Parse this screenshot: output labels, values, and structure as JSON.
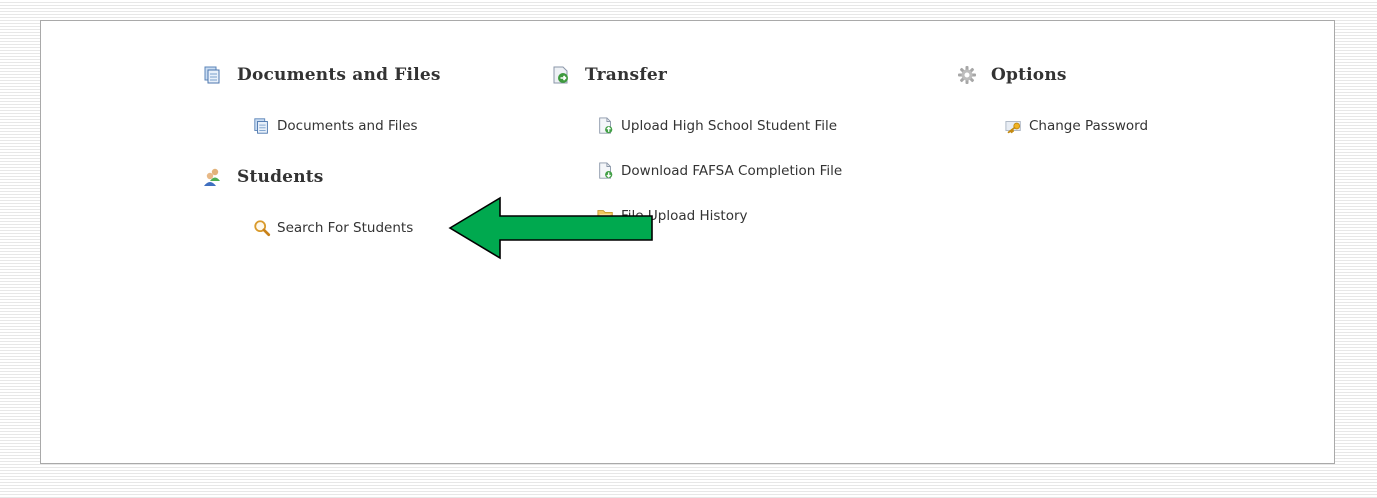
{
  "sections": {
    "documents": {
      "title": "Documents and Files",
      "icon": "documents-icon",
      "items": [
        {
          "label": "Documents and Files",
          "icon": "documents-icon"
        }
      ]
    },
    "students": {
      "title": "Students",
      "icon": "users-icon",
      "items": [
        {
          "label": "Search For Students",
          "icon": "magnifier-icon"
        }
      ]
    },
    "transfer": {
      "title": "Transfer",
      "icon": "transfer-icon",
      "items": [
        {
          "label": "Upload High School Student File",
          "icon": "file-upload-icon"
        },
        {
          "label": "Download FAFSA Completion File",
          "icon": "file-download-icon"
        },
        {
          "label": "File Upload History",
          "icon": "folder-icon"
        }
      ]
    },
    "options": {
      "title": "Options",
      "icon": "gear-icon",
      "items": [
        {
          "label": "Change Password",
          "icon": "key-icon"
        }
      ]
    }
  },
  "annotation": {
    "icon": "green-arrow-pointer",
    "color": "#00a94f"
  }
}
